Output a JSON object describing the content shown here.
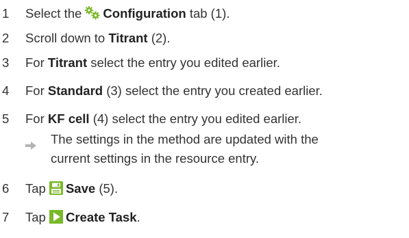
{
  "steps": [
    {
      "num": "1",
      "pre": "Select the ",
      "icon": "configuration-gear-icon",
      "bold": "Configuration",
      "post": " tab (1)."
    },
    {
      "num": "2",
      "pre": "Scroll down to ",
      "bold": "Titrant",
      "post": " (2)."
    },
    {
      "num": "3",
      "pre": "For ",
      "bold": "Titrant",
      "post": " select the entry you edited earlier."
    },
    {
      "num": "4",
      "pre": "For ",
      "bold": "Standard",
      "post": " (3) select the entry you created earlier."
    },
    {
      "num": "5",
      "pre": "For ",
      "bold": "KF cell",
      "post": " (4) select the entry you edited earlier."
    },
    {
      "num": "6",
      "pre": "Tap ",
      "icon": "save-icon",
      "bold": "Save",
      "post": " (5)."
    },
    {
      "num": "7",
      "pre": "Tap ",
      "icon": "create-task-play-icon",
      "bold": "Create Task",
      "post": "."
    }
  ],
  "result": {
    "icon": "result-arrow-icon",
    "line1": "The settings in the method are updated with the",
    "line2": "current settings in the resource entry."
  },
  "colors": {
    "text": "#333333",
    "icon_green": "#7ab829",
    "arrow_gray": "#b3b3b3"
  }
}
